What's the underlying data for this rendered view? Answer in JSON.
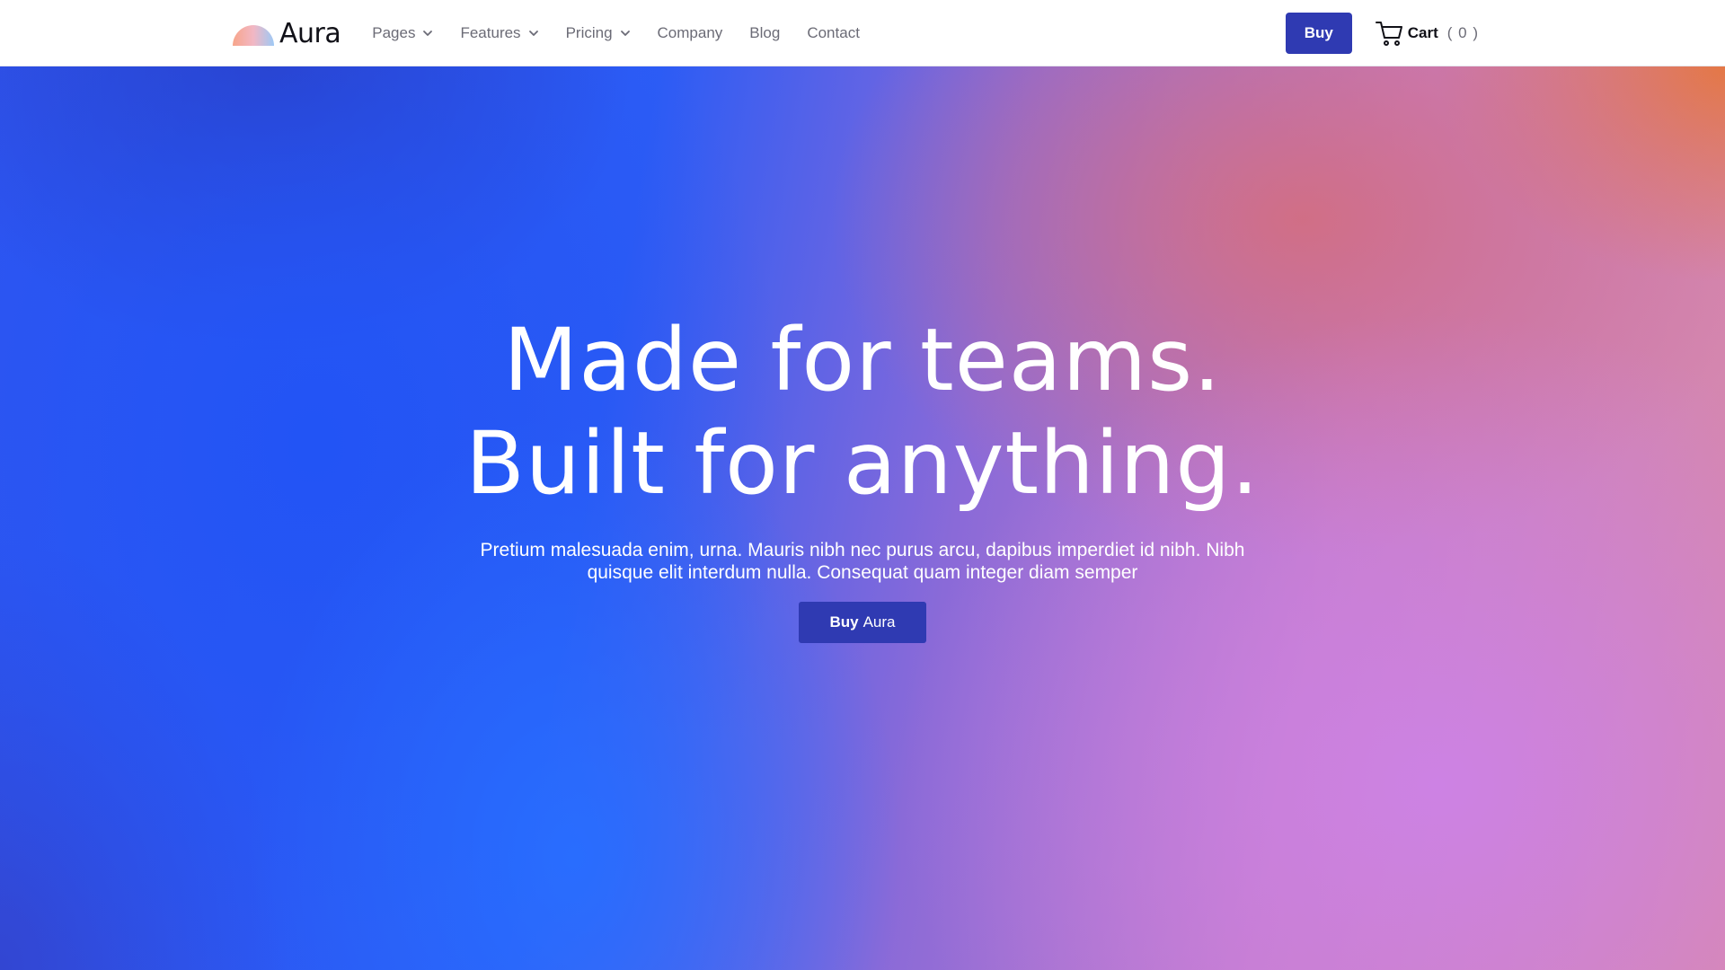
{
  "brand": {
    "name": "Aura",
    "accent_color": "#2f3ab2"
  },
  "nav": {
    "items": [
      {
        "label": "Pages",
        "has_dropdown": true,
        "icon": "chevron-down-icon"
      },
      {
        "label": "Features",
        "has_dropdown": true,
        "icon": "chevron-down-icon"
      },
      {
        "label": "Pricing",
        "has_dropdown": true,
        "icon": "chevron-down-icon"
      },
      {
        "label": "Company",
        "has_dropdown": false
      },
      {
        "label": "Blog",
        "has_dropdown": false
      },
      {
        "label": "Contact",
        "has_dropdown": false
      }
    ],
    "buy_label": "Buy",
    "cart_label": "Cart",
    "cart_count": "( 0 )",
    "cart_icon": "cart-icon"
  },
  "hero": {
    "headline_line1": "Made for teams.",
    "headline_line2": "Built for anything.",
    "subtext": "Pretium malesuada enim, urna. Mauris nibh nec purus arcu, dapibus imperdiet id nibh. Nibh quisque elit interdum nulla. Consequat quam integer diam semper",
    "cta_strong": "Buy",
    "cta_rest": "Aura"
  }
}
